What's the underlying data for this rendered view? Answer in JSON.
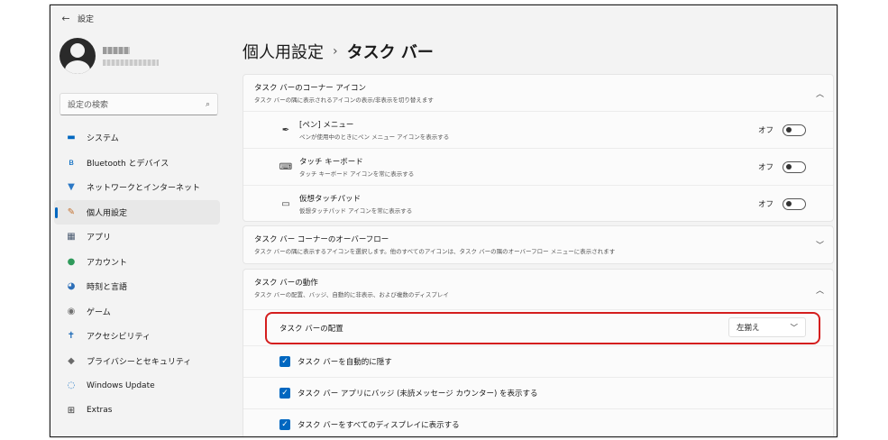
{
  "window": {
    "title": "設定"
  },
  "sidebar": {
    "search_placeholder": "設定の検索",
    "items": [
      {
        "label": "システム",
        "icon": "monitor-icon",
        "glyph": "▬",
        "color": "#0067c0"
      },
      {
        "label": "Bluetooth とデバイス",
        "icon": "bluetooth-icon",
        "glyph": "ʙ",
        "color": "#0067c0"
      },
      {
        "label": "ネットワークとインターネット",
        "icon": "wifi-icon",
        "glyph": "▼",
        "color": "#2b78c5"
      },
      {
        "label": "個人用設定",
        "icon": "brush-icon",
        "glyph": "✎",
        "color": "#c4712f",
        "active": true
      },
      {
        "label": "アプリ",
        "icon": "apps-icon",
        "glyph": "▦",
        "color": "#4a5a70"
      },
      {
        "label": "アカウント",
        "icon": "account-icon",
        "glyph": "●",
        "color": "#2f9a5b"
      },
      {
        "label": "時刻と言語",
        "icon": "globe-clock-icon",
        "glyph": "◕",
        "color": "#2d6fb8"
      },
      {
        "label": "ゲーム",
        "icon": "gamepad-icon",
        "glyph": "◉",
        "color": "#707070"
      },
      {
        "label": "アクセシビリティ",
        "icon": "accessibility-icon",
        "glyph": "✝",
        "color": "#1565b5"
      },
      {
        "label": "プライバシーとセキュリティ",
        "icon": "shield-icon",
        "glyph": "◆",
        "color": "#6a6a6a"
      },
      {
        "label": "Windows Update",
        "icon": "windows-update-icon",
        "glyph": "◌",
        "color": "#1a73c4"
      },
      {
        "label": "Extras",
        "icon": "extras-grid-icon",
        "glyph": "⊞",
        "color": "#333333"
      }
    ]
  },
  "main": {
    "breadcrumb_parent": "個人用設定",
    "breadcrumb_sep": "›",
    "breadcrumb_current": "タスク バー",
    "corner_icons": {
      "title": "タスク バーのコーナー アイコン",
      "subtitle": "タスク バーの隅に表示されるアイコンの表示/非表示を切り替えます",
      "expanded": true,
      "items": [
        {
          "title": "[ペン] メニュー",
          "subtitle": "ペンが使用中のときにペン メニュー アイコンを表示する",
          "icon": "pen-icon",
          "glyph": "✒",
          "state_label": "オフ"
        },
        {
          "title": "タッチ キーボード",
          "subtitle": "タッチ キーボード アイコンを常に表示する",
          "icon": "keyboard-icon",
          "glyph": "⌨",
          "state_label": "オフ"
        },
        {
          "title": "仮想タッチパッド",
          "subtitle": "仮想タッチパッド アイコンを常に表示する",
          "icon": "touchpad-icon",
          "glyph": "▭",
          "state_label": "オフ"
        }
      ]
    },
    "overflow": {
      "title": "タスク バー コーナーのオーバーフロー",
      "subtitle": "タスク バーの隅に表示するアイコンを選択します。他のすべてのアイコンは、タスク バーの隅のオーバーフロー メニューに表示されます",
      "expanded": false
    },
    "behavior": {
      "title": "タスク バーの動作",
      "subtitle": "タスク バーの配置、バッジ、自動的に非表示、および複数のディスプレイ",
      "expanded": true,
      "alignment_label": "タスク バーの配置",
      "alignment_value": "左揃え",
      "checks": [
        {
          "label": "タスク バーを自動的に隠す",
          "checked": true
        },
        {
          "label": "タスク バー アプリにバッジ (未読メッセージ カウンター) を表示する",
          "checked": true
        },
        {
          "label": "タスク バーをすべてのディスプレイに表示する",
          "checked": true
        }
      ]
    }
  },
  "colors": {
    "accent": "#0067c0",
    "highlight": "#d41e1e"
  }
}
